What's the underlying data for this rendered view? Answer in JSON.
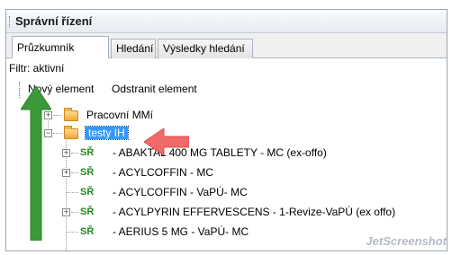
{
  "panel": {
    "title": "Správní řízení"
  },
  "tabs": [
    {
      "label": "Průzkumník"
    },
    {
      "label": "Hledání"
    },
    {
      "label": "Výsledky hledání"
    }
  ],
  "filter": {
    "text": "Filtr: aktivní"
  },
  "toolbar": {
    "new_label": "Nový element",
    "delete_label": "Odstranit element"
  },
  "tree": {
    "folders": [
      {
        "label": "Pracovní MMí"
      },
      {
        "label": "testy IH"
      }
    ],
    "items": [
      {
        "prefix": "SŘ",
        "label": "- ABAKTAL 400 MG TABLETY - MC (ex-offo)"
      },
      {
        "prefix": "SŘ",
        "label": "- ACYLCOFFIN - MC"
      },
      {
        "prefix": "SŘ",
        "label": "- ACYLCOFFIN - VaPÚ- MC"
      },
      {
        "prefix": "SŘ",
        "label": "- ACYLPYRIN EFFERVESCENS - 1-Revize-VaPÚ (ex offo)"
      },
      {
        "prefix": "SŘ",
        "label": "- AERIUS 5 MG - VaPÚ- MC"
      }
    ]
  },
  "watermark": {
    "text": "JetScreenshot"
  },
  "colors": {
    "annotation_green": "#3a9a3a",
    "annotation_red": "#f06a6a",
    "selection": "#3399ff",
    "sr_green": "#1f8a1f"
  }
}
